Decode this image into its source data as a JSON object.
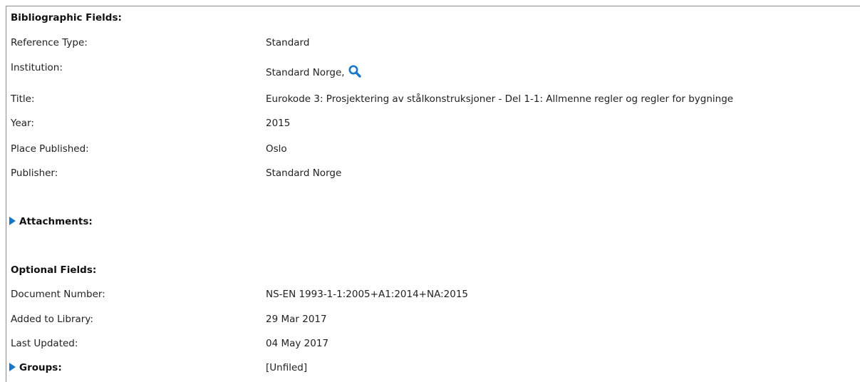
{
  "bibliographic": {
    "section_title": "Bibliographic Fields:",
    "fields": [
      {
        "label": "Reference Type:",
        "value": "Standard"
      },
      {
        "label": "Institution:",
        "value": "Standard Norge,"
      },
      {
        "label": "Title:",
        "value": "Eurokode 3: Prosjektering av stålkonstruksjoner - Del 1-1: Allmenne regler og regler for bygninge"
      },
      {
        "label": "Year:",
        "value": "2015"
      },
      {
        "label": "Place Published:",
        "value": "Oslo"
      },
      {
        "label": "Publisher:",
        "value": "Standard Norge"
      }
    ],
    "search_icon": "search-icon"
  },
  "attachments": {
    "label": "Attachments:"
  },
  "optional": {
    "section_title": "Optional Fields:",
    "fields": [
      {
        "label": "Document Number:",
        "value": "NS-EN 1993-1-1:2005+A1:2014+NA:2015"
      },
      {
        "label": "Added to Library:",
        "value": "29 Mar 2017"
      },
      {
        "label": "Last Updated:",
        "value": "04 May 2017"
      }
    ]
  },
  "groups": {
    "label": "Groups:",
    "value": "[Unfiled]"
  },
  "colors": {
    "accent": "#1976c6",
    "border": "#8a8a8a",
    "text": "#222222"
  }
}
